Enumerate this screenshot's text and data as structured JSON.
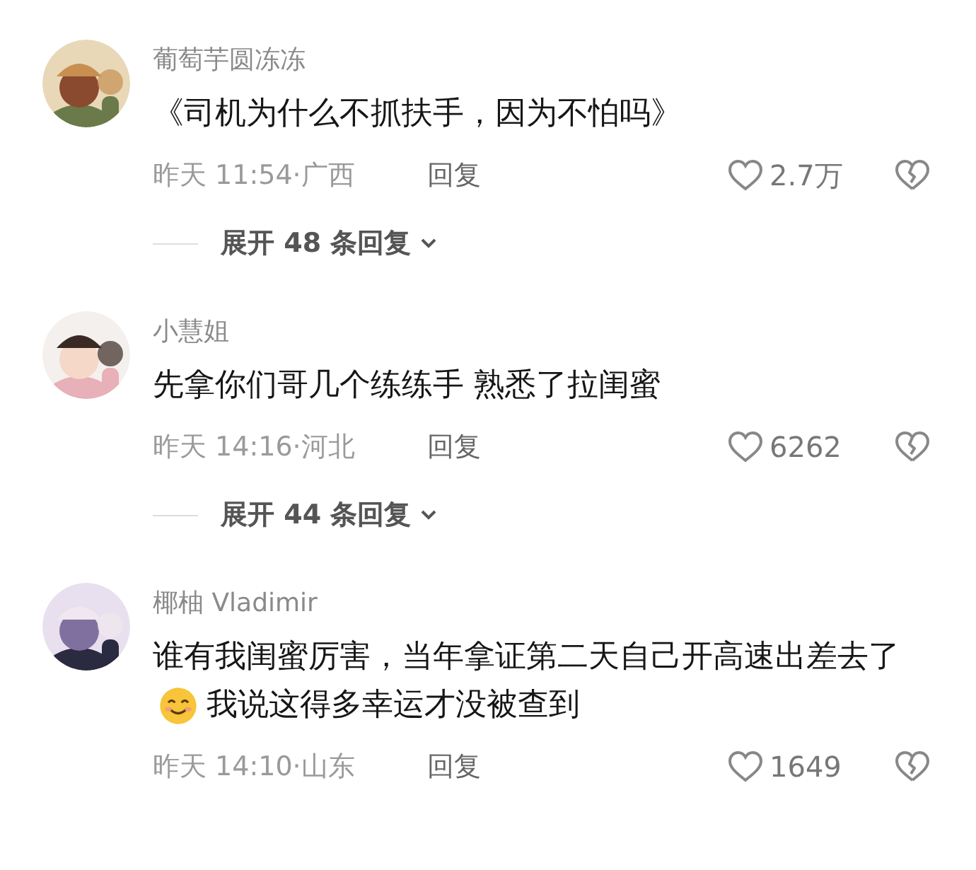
{
  "comments": [
    {
      "name": "葡萄芋圆冻冻",
      "text": [
        {
          "kind": "text",
          "value": "《司机为什么不抓扶手，因为不怕吗》"
        }
      ],
      "meta": "昨天 11:54·广西",
      "reply": "回复",
      "likes": "2.7万",
      "expand": "展开 48 条回复"
    },
    {
      "name": "小慧姐",
      "text": [
        {
          "kind": "text",
          "value": "先拿你们哥几个练练手 熟悉了拉闺蜜"
        }
      ],
      "meta": "昨天 14:16·河北",
      "reply": "回复",
      "likes": "6262",
      "expand": "展开 44 条回复"
    },
    {
      "name": "椰柚 Vladimir",
      "text": [
        {
          "kind": "text",
          "value": "谁有我闺蜜厉害，当年拿证第二天自己开高速出"
        },
        {
          "kind": "text",
          "value": "差去了"
        },
        {
          "kind": "emoji"
        },
        {
          "kind": "text",
          "value": "我说这得多幸运才没被查到"
        }
      ],
      "meta": "昨天 14:10·山东",
      "reply": "回复",
      "likes": "1649"
    }
  ]
}
